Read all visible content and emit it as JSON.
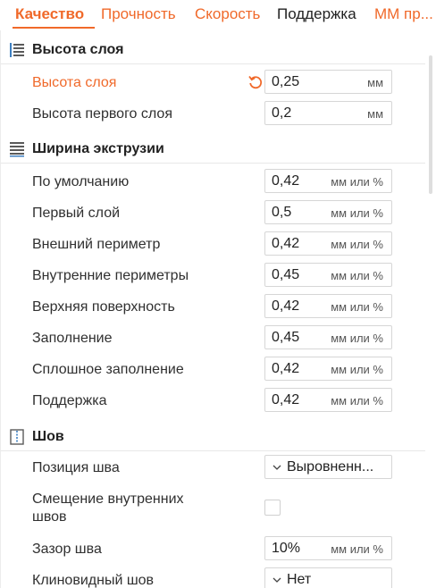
{
  "tabs": [
    {
      "label": "Качество"
    },
    {
      "label": "Прочность"
    },
    {
      "label": "Скорость"
    },
    {
      "label": "Поддержка"
    },
    {
      "label": "ММ пр..."
    }
  ],
  "sections": {
    "layer_height": {
      "title": "Высота слоя",
      "rows": [
        {
          "label": "Высота слоя",
          "value": "0,25",
          "unit": "мм"
        },
        {
          "label": "Высота первого слоя",
          "value": "0,2",
          "unit": "мм"
        }
      ]
    },
    "extrusion_width": {
      "title": "Ширина экструзии",
      "rows": [
        {
          "label": "По умолчанию",
          "value": "0,42",
          "unit": "мм или %"
        },
        {
          "label": "Первый слой",
          "value": "0,5",
          "unit": "мм или %"
        },
        {
          "label": "Внешний периметр",
          "value": "0,42",
          "unit": "мм или %"
        },
        {
          "label": "Внутренние периметры",
          "value": "0,45",
          "unit": "мм или %"
        },
        {
          "label": "Верхняя поверхность",
          "value": "0,42",
          "unit": "мм или %"
        },
        {
          "label": "Заполнение",
          "value": "0,45",
          "unit": "мм или %"
        },
        {
          "label": "Сплошное заполнение",
          "value": "0,42",
          "unit": "мм или %"
        },
        {
          "label": "Поддержка",
          "value": "0,42",
          "unit": "мм или %"
        }
      ]
    },
    "seam": {
      "title": "Шов",
      "seam_position": {
        "label": "Позиция шва",
        "value": "Выровненн..."
      },
      "staggered": {
        "label_line1": "Смещение внутренних",
        "label_line2": "швов",
        "checked": false
      },
      "seam_gap": {
        "label": "Зазор шва",
        "value": "10%",
        "unit": "мм или %"
      },
      "scarf_seam": {
        "label": "Клиновидный шов",
        "value": "Нет"
      }
    }
  },
  "colors": {
    "accent": "#f0692a",
    "border": "#d6d6d6",
    "text": "#303030"
  },
  "icons": {
    "layer_height": "layers-icon",
    "extrusion_width": "extrusion-width-icon",
    "seam": "seam-icon",
    "reset": "reset-arrow-icon",
    "dropdown": "chevron-down-icon"
  }
}
